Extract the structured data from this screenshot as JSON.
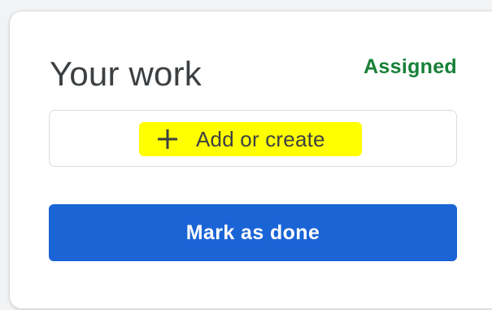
{
  "work_card": {
    "title": "Your work",
    "status": "Assigned",
    "add_button": {
      "icon": "plus-icon",
      "label": "Add or create"
    },
    "mark_done_button": {
      "label": "Mark as done"
    }
  },
  "colors": {
    "status_green": "#188038",
    "primary_blue": "#1a64d6",
    "highlight_yellow": "#ffff00"
  }
}
